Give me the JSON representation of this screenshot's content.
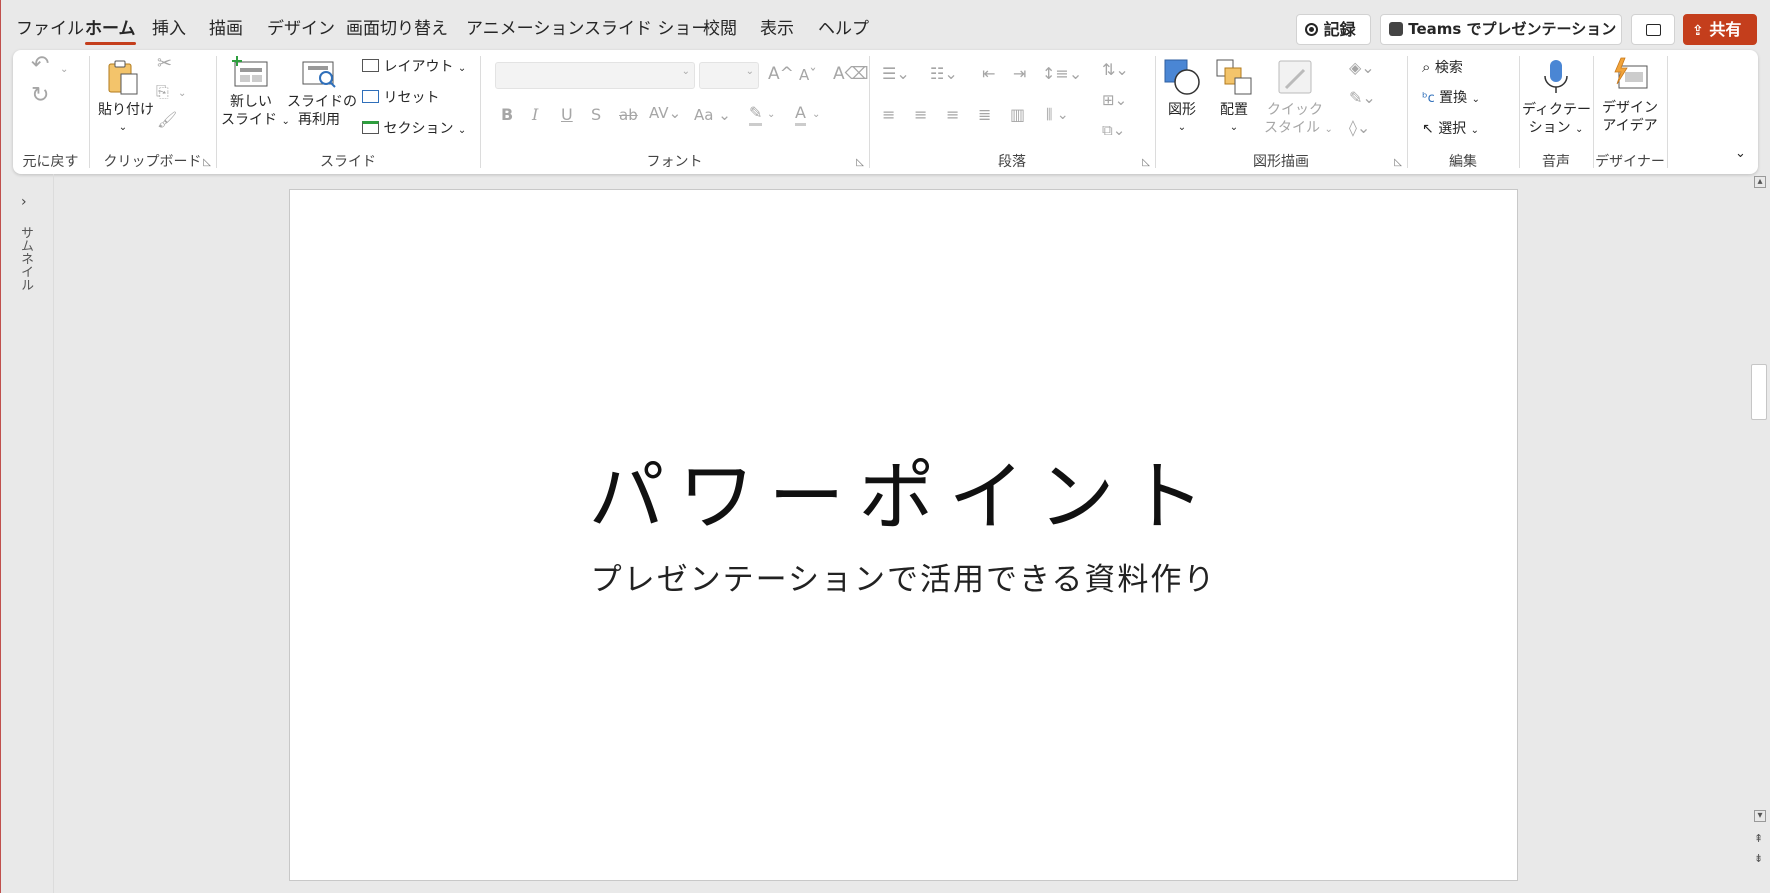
{
  "menu": {
    "tabs": [
      "ファイル",
      "ホーム",
      "挿入",
      "描画",
      "デザイン",
      "画面切り替え",
      "アニメーション",
      "スライド ショー",
      "校閲",
      "表示",
      "ヘルプ"
    ],
    "active_tab": "ホーム",
    "record_label": "記録",
    "teams_label": "Teams でプレゼンテーション",
    "share_label": "共有"
  },
  "ribbon": {
    "undo": {
      "group_label": "元に戻す"
    },
    "clipboard": {
      "paste_label": "貼り付け",
      "group_label": "クリップボード"
    },
    "slides": {
      "new_slide_line1": "新しい",
      "new_slide_line2": "スライド",
      "reuse_line1": "スライドの",
      "reuse_line2": "再利用",
      "layout_label": "レイアウト",
      "reset_label": "リセット",
      "section_label": "セクション",
      "group_label": "スライド"
    },
    "font": {
      "group_label": "フォント",
      "case_label": "Aa"
    },
    "paragraph": {
      "group_label": "段落"
    },
    "drawing": {
      "shapes_label": "図形",
      "arrange_label": "配置",
      "quick_style_line1": "クイック",
      "quick_style_line2": "スタイル",
      "group_label": "図形描画"
    },
    "editing": {
      "find_label": "検索",
      "replace_label": "置換",
      "select_label": "選択",
      "group_label": "編集"
    },
    "voice": {
      "dictate_line1": "ディクテー",
      "dictate_line2": "ション",
      "group_label": "音声"
    },
    "designer": {
      "ideas_line1": "デザイン",
      "ideas_line2": "アイデア",
      "group_label": "デザイナー"
    }
  },
  "left_pane": {
    "thumbnails_label": "サムネイル"
  },
  "slide": {
    "title": "パワーポイント",
    "subtitle": "プレゼンテーションで活用できる資料作り"
  },
  "colors": {
    "accent": "#c43e1c",
    "ribbon_bg": "#ffffff",
    "app_bg": "#e9e9e9"
  }
}
